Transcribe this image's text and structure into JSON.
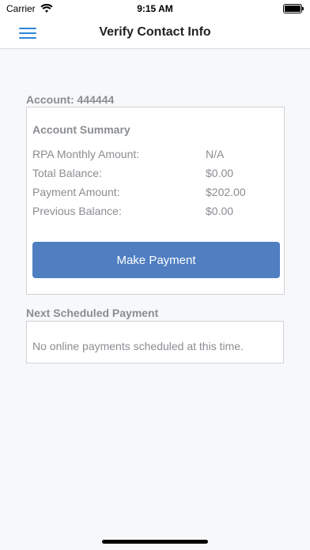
{
  "status_bar": {
    "carrier": "Carrier",
    "time": "9:15 AM"
  },
  "nav": {
    "title": "Verify Contact Info"
  },
  "account": {
    "label": "Account: 444444"
  },
  "summary": {
    "title": "Account Summary",
    "rows": [
      {
        "label": "RPA Monthly Amount:",
        "value": "N/A"
      },
      {
        "label": "Total Balance:",
        "value": "$0.00"
      },
      {
        "label": "Payment Amount:",
        "value": "$202.00"
      },
      {
        "label": "Previous Balance:",
        "value": "$0.00"
      }
    ],
    "button_label": "Make Payment"
  },
  "next_payment": {
    "title": "Next Scheduled Payment",
    "message": "No online payments scheduled at this time."
  },
  "colors": {
    "accent": "#2f86d6",
    "button": "#4f7fc1",
    "muted_text": "#8a8d91"
  },
  "icons": {
    "menu": "hamburger-menu-icon",
    "wifi": "wifi-icon",
    "battery": "battery-icon"
  }
}
